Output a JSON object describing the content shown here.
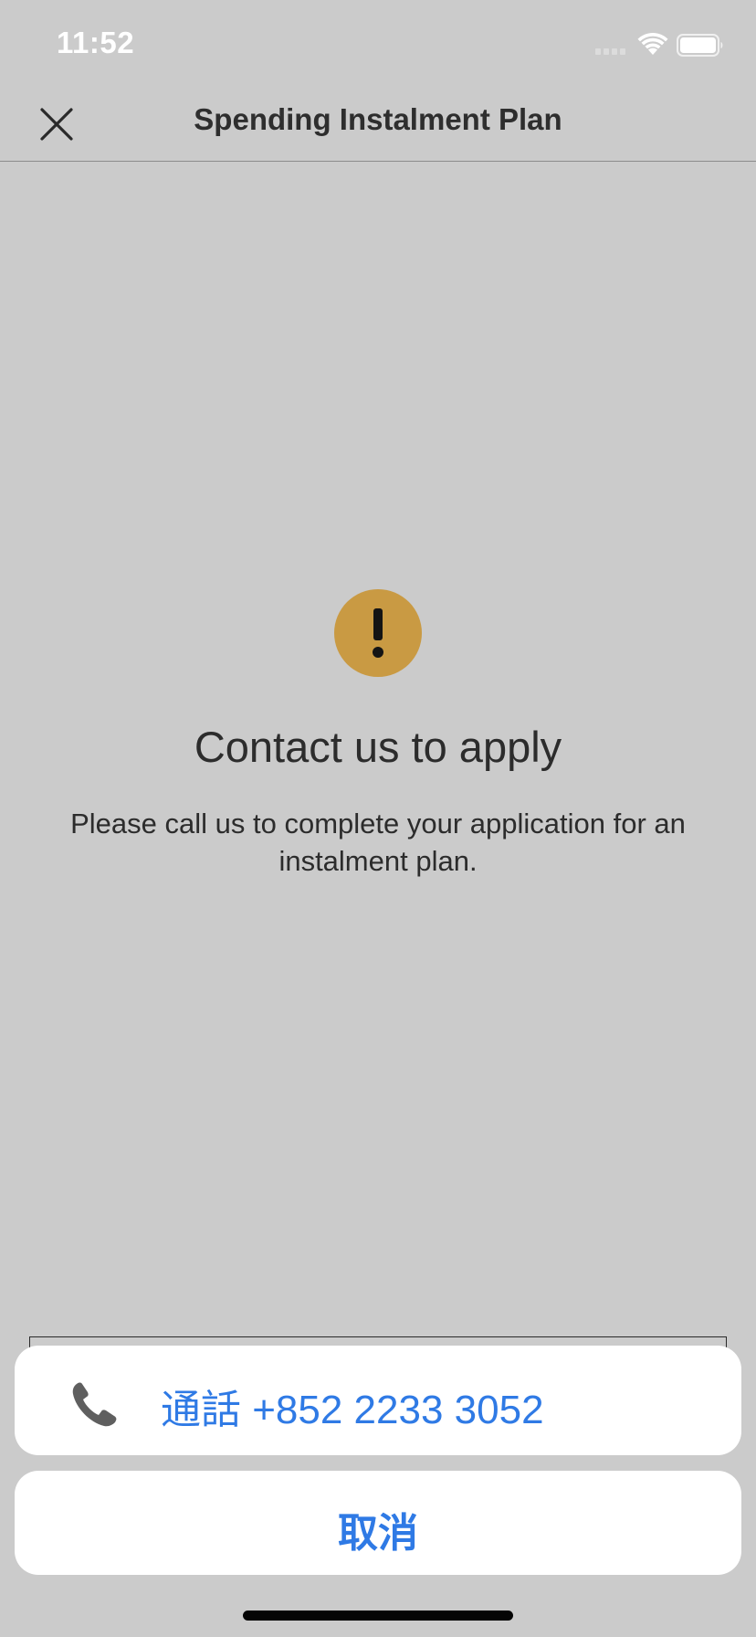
{
  "status_bar": {
    "time": "11:52"
  },
  "header": {
    "title": "Spending Instalment Plan",
    "close_icon": "close-icon"
  },
  "main": {
    "icon": "exclamation-icon",
    "icon_color": "#c99a43",
    "heading": "Contact us to apply",
    "message": "Please call us to complete your application for an instalment plan."
  },
  "action_sheet": {
    "call_icon": "phone-icon",
    "call_label": "通話 +852 2233 3052",
    "cancel_label": "取消",
    "accent_color": "#2f7ae5"
  }
}
